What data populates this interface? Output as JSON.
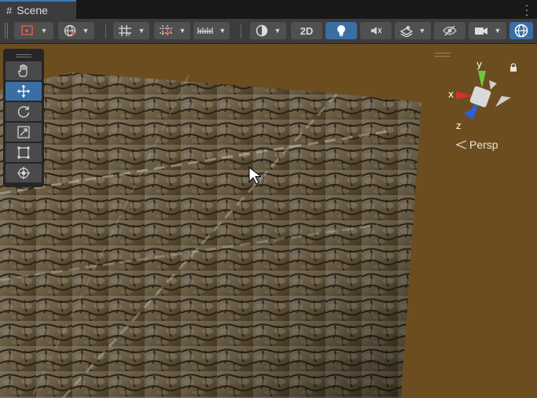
{
  "tab": {
    "title": "Scene",
    "icon": "grid-icon"
  },
  "toolbar": {
    "view_2d_label": "2D",
    "buttons": [
      "gizmo-toggle",
      "global-local-toggle",
      "grid-visibility",
      "grid-snapping",
      "increment-snap",
      "draw-mode",
      "2d-toggle",
      "lighting-toggle",
      "audio-toggle",
      "effects-toggle",
      "hidden-objects-toggle",
      "camera-settings",
      "gizmos-toggle"
    ]
  },
  "tools": [
    {
      "name": "view-tool",
      "icon": "hand-icon",
      "active": false
    },
    {
      "name": "move-tool",
      "icon": "move-arrows-icon",
      "active": true
    },
    {
      "name": "rotate-tool",
      "icon": "rotate-icon",
      "active": false
    },
    {
      "name": "scale-tool",
      "icon": "scale-icon",
      "active": false
    },
    {
      "name": "rect-tool",
      "icon": "rect-icon",
      "active": false
    },
    {
      "name": "transform-tool",
      "icon": "transform-icon",
      "active": false
    }
  ],
  "gizmo": {
    "projection_label": "Persp",
    "axes": {
      "x": "x",
      "y": "y",
      "z": "z"
    },
    "colors": {
      "x": "#d2322d",
      "y": "#6cc93a",
      "z": "#2f5fd8"
    }
  },
  "colors": {
    "accent": "#3a6fa3",
    "background": "#6b4d20",
    "toolbar": "#3c3c3c"
  }
}
